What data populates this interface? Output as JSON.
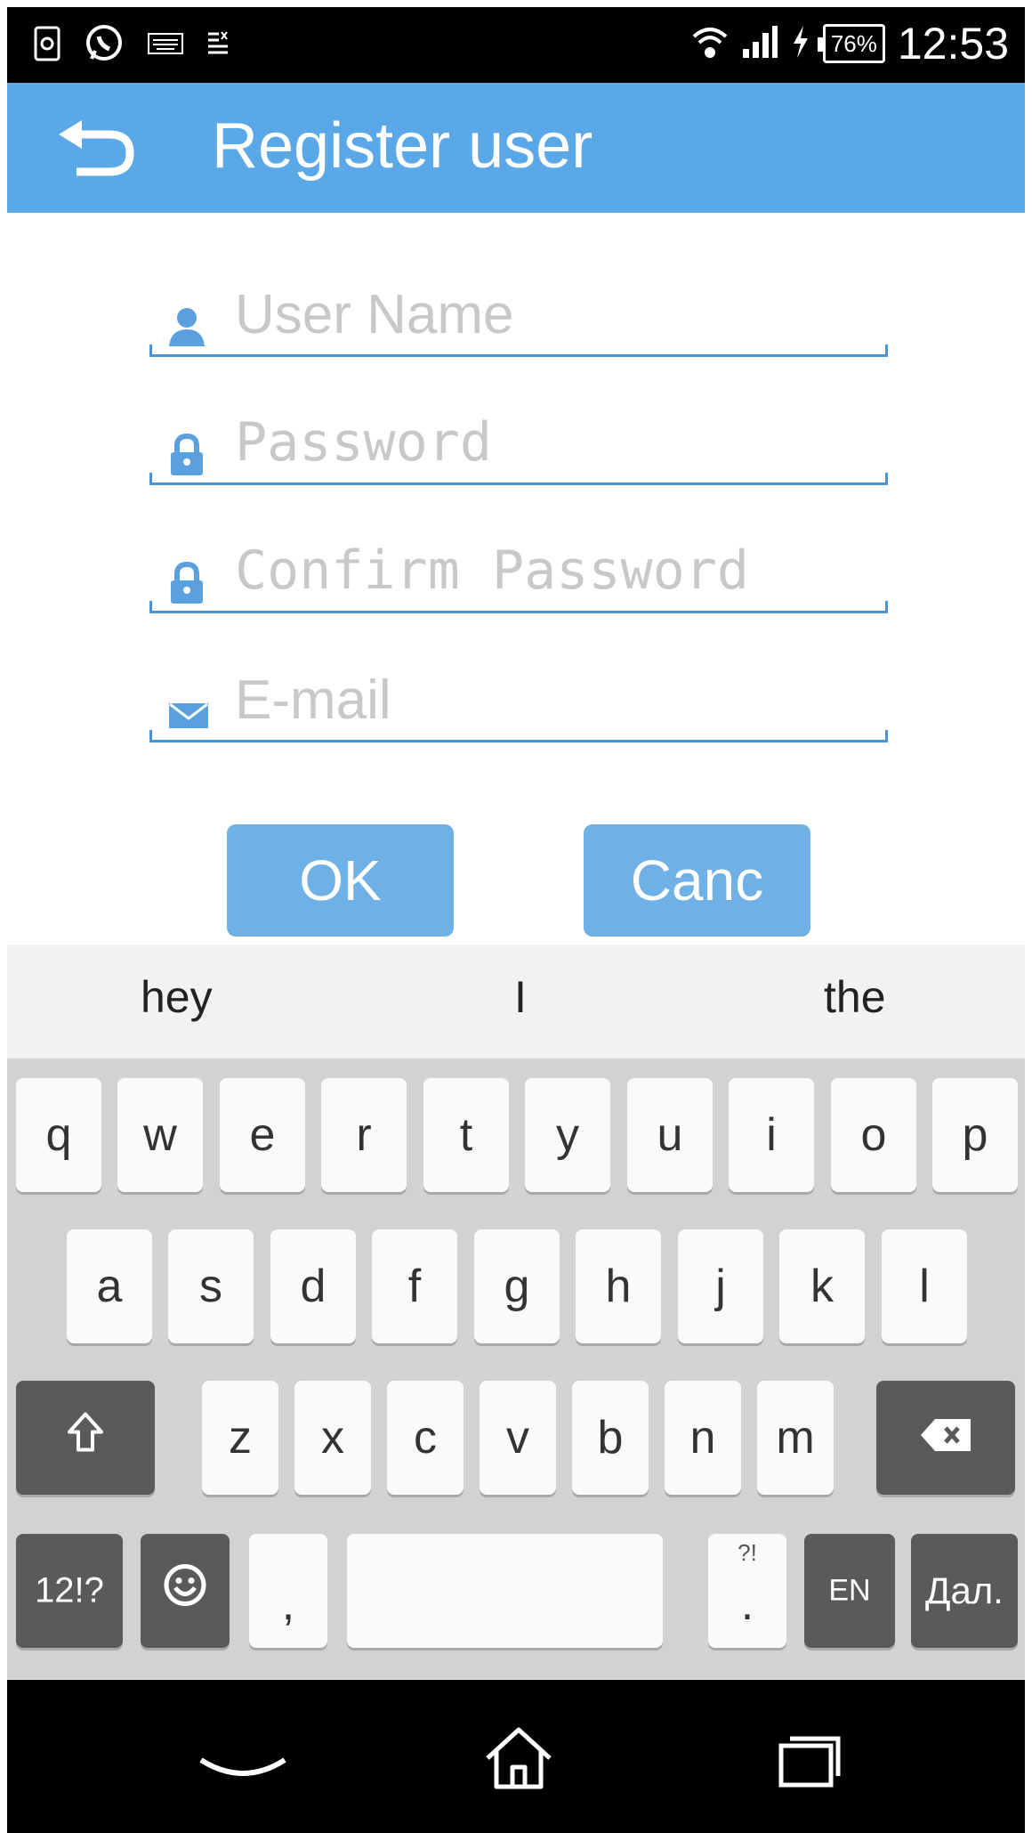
{
  "status_bar": {
    "left_icons": [
      "screenshot-icon",
      "whatsapp-icon",
      "keyboard-icon",
      "input-method-icon"
    ],
    "battery": "76%",
    "time": "12:53"
  },
  "app_bar": {
    "title": "Register user",
    "back_icon": "back-arrow-icon"
  },
  "form": {
    "username": {
      "placeholder": "User Name",
      "icon": "user-icon",
      "value": ""
    },
    "password": {
      "placeholder": "Password",
      "icon": "lock-icon",
      "value": ""
    },
    "confirm_password": {
      "placeholder": "Confirm Password",
      "icon": "lock-icon",
      "value": ""
    },
    "email": {
      "placeholder": "E-mail",
      "icon": "mail-icon",
      "value": ""
    }
  },
  "buttons": {
    "ok": "OK",
    "cancel": "Canc"
  },
  "colors": {
    "accent": "#5aa8e7",
    "button": "#6fb0e6",
    "underline": "#4b93d3"
  },
  "keyboard": {
    "suggestions": [
      "hey",
      "I",
      "the"
    ],
    "row1": [
      "q",
      "w",
      "e",
      "r",
      "t",
      "y",
      "u",
      "i",
      "o",
      "p"
    ],
    "row2": [
      "a",
      "s",
      "d",
      "f",
      "g",
      "h",
      "j",
      "k",
      "l"
    ],
    "row3": [
      "z",
      "x",
      "c",
      "v",
      "b",
      "n",
      "m"
    ],
    "shift_icon": "shift-arrow-icon",
    "backspace_icon": "backspace-icon",
    "symbols_label": "12!?",
    "emoji_icon": "smiley-icon",
    "comma": ",",
    "period": ".",
    "period_hint": "?!",
    "language": "EN",
    "enter_label": "Дал."
  },
  "nav_bar": {
    "back_icon": "chevron-down-icon",
    "home_icon": "home-icon",
    "recents_icon": "recents-icon"
  }
}
